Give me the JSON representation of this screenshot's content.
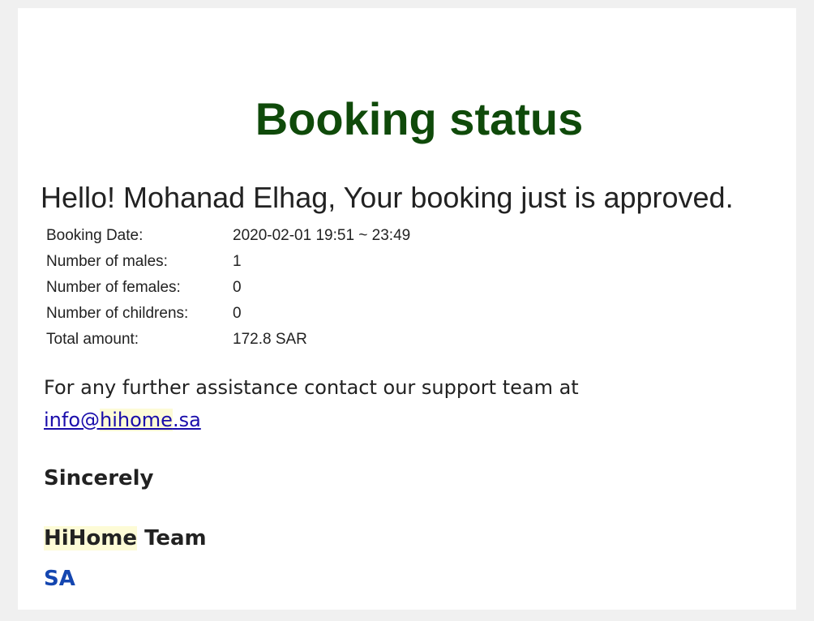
{
  "email": {
    "title": "Booking status",
    "greeting": "Hello! Mohanad Elhag, Your booking just is approved.",
    "details": [
      {
        "label": "Booking Date:",
        "value": "2020-02-01 19:51 ~ 23:49"
      },
      {
        "label": "Number of males:",
        "value": "1"
      },
      {
        "label": "Number of females:",
        "value": "0"
      },
      {
        "label": "Number of childrens:",
        "value": "0"
      },
      {
        "label": "Total amount:",
        "value": "172.8 SAR"
      }
    ],
    "support_text": "For any further assistance contact our support team at",
    "support_email_prefix": "info@",
    "support_email_highlight": "hihome",
    "support_email_suffix": ".sa",
    "closing": "Sincerely",
    "team_brand": "HiHome",
    "team_word": " Team",
    "region": "SA"
  },
  "colors": {
    "title": "#0f4a0a",
    "link": "#1a0dab",
    "highlight": "#fdfbd6",
    "region": "#1446b0",
    "background": "#f0f0f0"
  }
}
